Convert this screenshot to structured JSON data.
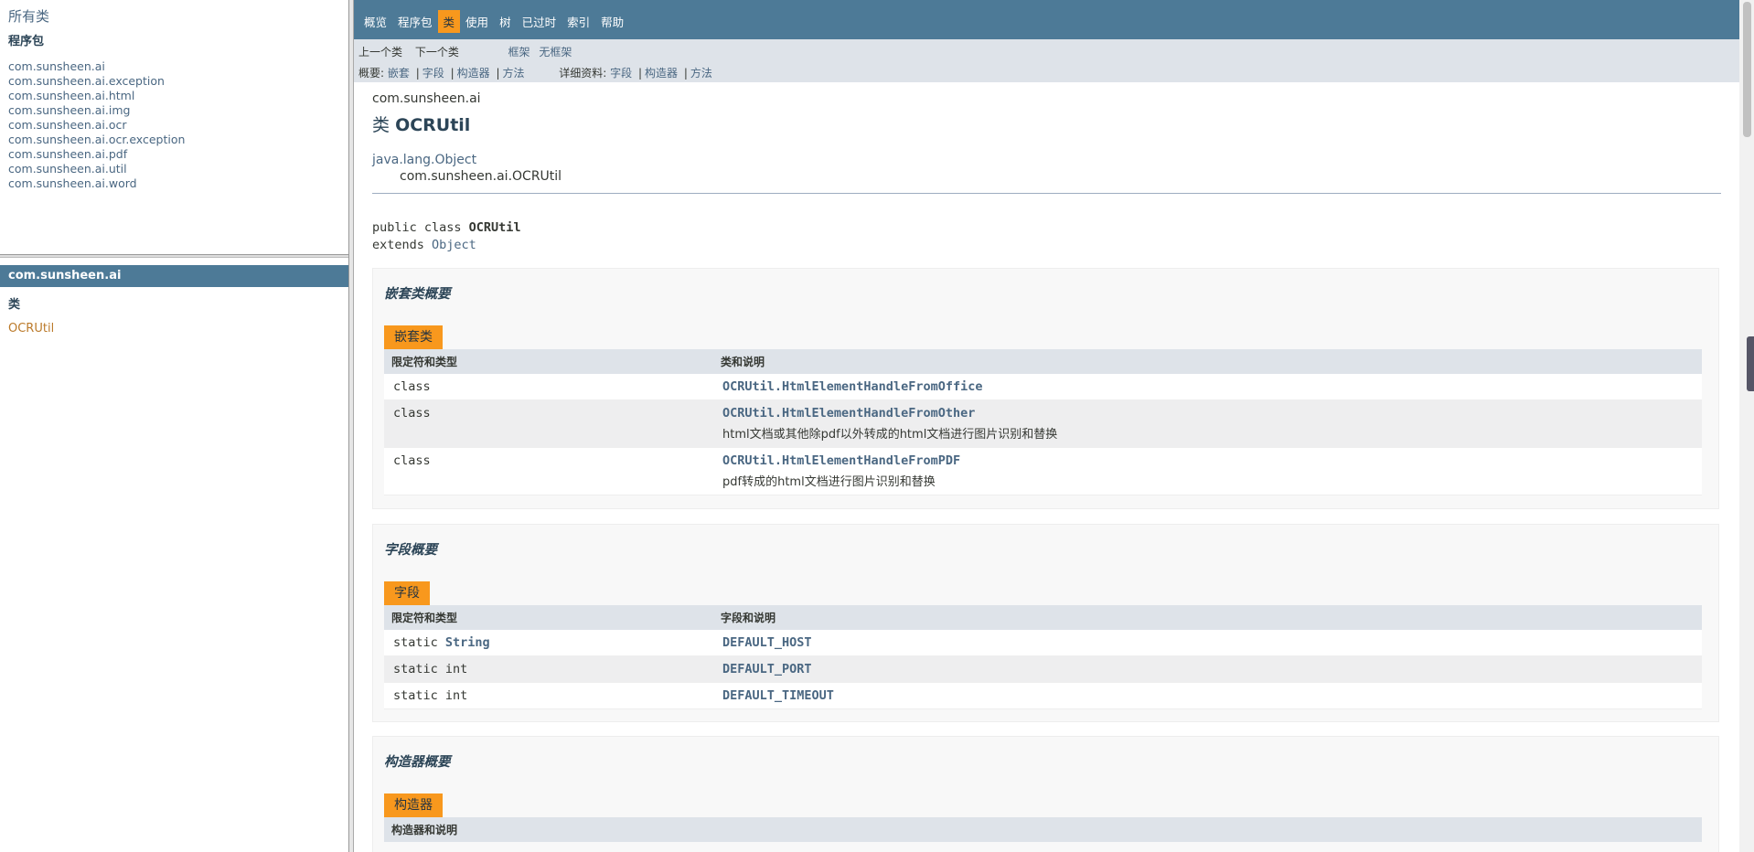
{
  "left_top": {
    "all_classes": "所有类",
    "packages_heading": "程序包",
    "packages": [
      "com.sunsheen.ai",
      "com.sunsheen.ai.exception",
      "com.sunsheen.ai.html",
      "com.sunsheen.ai.img",
      "com.sunsheen.ai.ocr",
      "com.sunsheen.ai.ocr.exception",
      "com.sunsheen.ai.pdf",
      "com.sunsheen.ai.util",
      "com.sunsheen.ai.word"
    ]
  },
  "left_bottom": {
    "package_title": "com.sunsheen.ai",
    "classes_heading": "类",
    "classes": [
      "OCRUtil"
    ]
  },
  "topnav": {
    "items": [
      "概览",
      "程序包",
      "类",
      "使用",
      "树",
      "已过时",
      "索引",
      "帮助"
    ],
    "active_index": 2
  },
  "subnav": {
    "prev_class": "上一个类",
    "next_class": "下一个类",
    "frames": "框架",
    "no_frames": "无框架",
    "summary_label": "概要:",
    "summary_nested": "嵌套",
    "summary_field": "字段",
    "summary_constr": "构造器",
    "summary_method": "方法",
    "detail_label": "详细资料:",
    "detail_field": "字段",
    "detail_constr": "构造器",
    "detail_method": "方法",
    "sep": "|"
  },
  "header": {
    "package": "com.sunsheen.ai",
    "title_prefix": "类",
    "title_name": "OCRUtil"
  },
  "inheritance": {
    "parent": "java.lang.Object",
    "child": "com.sunsheen.ai.OCRUtil"
  },
  "signature": {
    "line1_prefix": "public class ",
    "line1_name": "OCRUtil",
    "line2_prefix": "extends ",
    "line2_link": "Object"
  },
  "nested_summary": {
    "heading": "嵌套类概要",
    "caption": "嵌套类",
    "col1": "限定符和类型",
    "col2": "类和说明",
    "rows": [
      {
        "type": "class",
        "name": "OCRUtil.HtmlElementHandleFromOffice",
        "desc": ""
      },
      {
        "type": "class",
        "name": "OCRUtil.HtmlElementHandleFromOther",
        "desc": "html文档或其他除pdf以外转成的html文档进行图片识别和替换"
      },
      {
        "type": "class",
        "name": "OCRUtil.HtmlElementHandleFromPDF",
        "desc": "pdf转成的html文档进行图片识别和替换"
      }
    ]
  },
  "field_summary": {
    "heading": "字段概要",
    "caption": "字段",
    "col1": "限定符和类型",
    "col2": "字段和说明",
    "rows": [
      {
        "type_prefix": "static ",
        "type_link": "String",
        "name": "DEFAULT_HOST"
      },
      {
        "type_prefix": "static int",
        "type_link": "",
        "name": "DEFAULT_PORT"
      },
      {
        "type_prefix": "static int",
        "type_link": "",
        "name": "DEFAULT_TIMEOUT"
      }
    ]
  },
  "constructor_summary": {
    "heading": "构造器概要",
    "caption": "构造器",
    "col1": "构造器和说明"
  }
}
